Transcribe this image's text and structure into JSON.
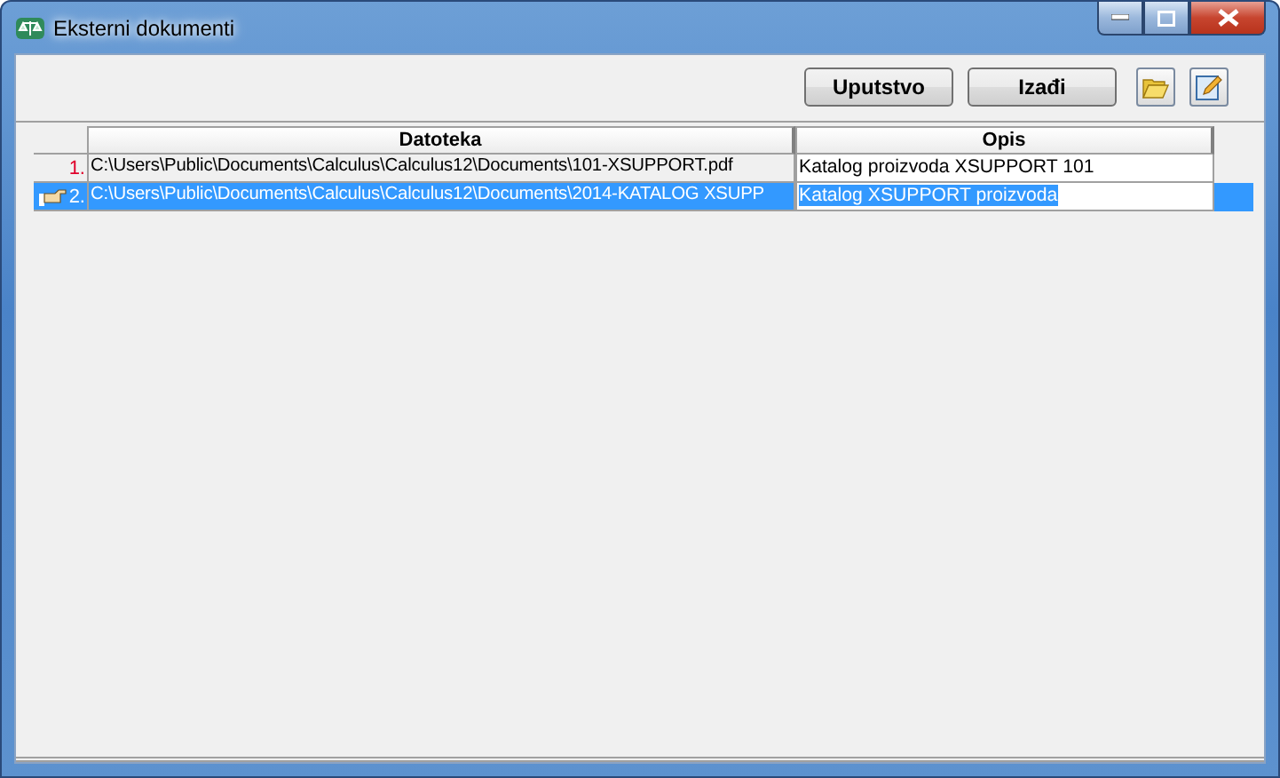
{
  "window": {
    "title": "Eksterni dokumenti"
  },
  "toolbar": {
    "buttons": [
      "Uputstvo",
      "Izađi"
    ]
  },
  "table": {
    "columns": [
      "Datoteka",
      "Opis"
    ],
    "rows": [
      {
        "number": "1.",
        "file": "C:\\Users\\Public\\Documents\\Calculus\\Calculus12\\Documents\\101-XSUPPORT.pdf",
        "description": "Katalog proizvoda XSUPPORT 101",
        "selected": false
      },
      {
        "number": "2.",
        "file": "C:\\Users\\Public\\Documents\\Calculus\\Calculus12\\Documents\\2014-KATALOG XSUPP",
        "description": "Katalog XSUPPORT proizvoda",
        "selected": true
      }
    ]
  }
}
